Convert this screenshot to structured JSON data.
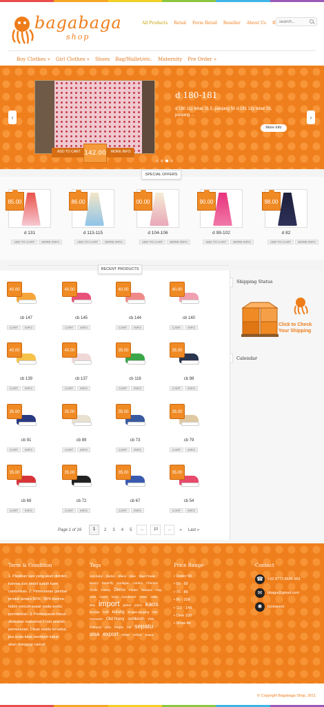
{
  "colors": {
    "brand": "#ef7f1d",
    "stripe": [
      "#e84c4c",
      "#f5a623",
      "#f2d024",
      "#8cc63f",
      "#3cb4e5",
      "#9b59b6"
    ]
  },
  "logo": {
    "word": "bagabaga",
    "sub": "shop"
  },
  "topnav": [
    {
      "label": "All Products",
      "active": true
    },
    {
      "label": "Retail"
    },
    {
      "label": "Form Retail"
    },
    {
      "label": "Reseller"
    },
    {
      "label": "About Us"
    },
    {
      "label": "Blog"
    }
  ],
  "search": {
    "placeholder": "search..."
  },
  "catnav": [
    "Boy Clothes »",
    "Girl Clothes »",
    "Shoes",
    "Bag/Wallet/etc.",
    "Maternity",
    "Pre Order »"
  ],
  "slider": {
    "title": "d 180-181",
    "desc": "d 180 11y lebar 31,5, panjang 50 d 181 13y lebar 33, panjang ...",
    "price": "142.00",
    "add_label": "ADD TO CART",
    "info_label": "MORE INFO",
    "more_label": "More Info",
    "prev": "‹",
    "next": "›"
  },
  "special": {
    "label": "SPECIAL OFFERS",
    "items": [
      {
        "name": "d 131",
        "price": "85.00"
      },
      {
        "name": "d 113-115",
        "price": "86.00"
      },
      {
        "name": "d 104-106",
        "price": "00.00"
      },
      {
        "name": "d 99-102",
        "price": "90.00"
      },
      {
        "name": "d 82",
        "price": "98.00"
      }
    ],
    "add": "ADD TO CART",
    "info": "MORE INFO"
  },
  "recent": {
    "label": "RECENT PRODUCTS",
    "cart": "CART",
    "info": "INFO",
    "items": [
      {
        "name": "cb 147",
        "price": "40.00"
      },
      {
        "name": "cb 145",
        "price": "40.00"
      },
      {
        "name": "cb 144",
        "price": "40.00"
      },
      {
        "name": "cb 140",
        "price": "40.00"
      },
      {
        "name": "cb 139",
        "price": "40.00"
      },
      {
        "name": "cb 137",
        "price": "40.00"
      },
      {
        "name": "cb 116",
        "price": "35.00"
      },
      {
        "name": "cb 98",
        "price": "35.00"
      },
      {
        "name": "cb 91",
        "price": "35.00"
      },
      {
        "name": "cb 89",
        "price": "35.00"
      },
      {
        "name": "cb 73",
        "price": "35.00"
      },
      {
        "name": "cb 79",
        "price": "35.00"
      },
      {
        "name": "cb 69",
        "price": "35.00"
      },
      {
        "name": "cb 72",
        "price": "35.00"
      },
      {
        "name": "cb 67",
        "price": "35.00"
      },
      {
        "name": "cb 54",
        "price": "35.00"
      }
    ]
  },
  "pagination": {
    "info": "Page 1 of 16",
    "pages": [
      "1",
      "2",
      "3",
      "4",
      "5",
      "...",
      "10",
      "...",
      "»",
      "Last »"
    ]
  },
  "sidebar": {
    "shipping": "Shipping Status",
    "ship_cta": "Click to Check Your Shipping",
    "calendar": "Calendar"
  },
  "footer": {
    "terms_title": "Term & Condition",
    "terms": "1. Pastikan size yang akan diorder, karena size detail sudah kami cantumkan. 2. Pemesanan gambar produk antara 80% - 95% karena faktor pencahayaan pada waktu pemotretan. 3. Pembayaran harus dilakukan maksimal 2 hari setelah pemesanan. Diluar waktu tersebut, jika anda tidak memberi kabar akan dianggap cancel.",
    "tags_title": "Tags",
    "tags": [
      "Anti baby",
      "Barbie",
      "Blank",
      "Blue",
      "Blue Flower",
      "Bunny",
      "Butterfly",
      "Cardigan",
      "Carters",
      "Cherries",
      "Circle",
      "Disney",
      "Dress",
      "Faded",
      "Glasses",
      "Gap",
      "Girls",
      "Green",
      "Grey",
      "Gymboree",
      "Heart",
      "Hello kitty",
      "import",
      "jacket",
      "jeans",
      "kaos",
      "kemeja",
      "kuffi",
      "kutung",
      "lengan panjang",
      "Mix",
      "momcare",
      "Old Navy",
      "oshkosh",
      "Pink",
      "Polkadot",
      "polo",
      "Purple",
      "rok",
      "sepatu",
      "sisa",
      "export",
      "White",
      "Yellow",
      "Zaara"
    ],
    "price_title": "Price Range",
    "prices": [
      "Under 50",
      "50 - 69",
      "70 - 89",
      "90 - 109",
      "110 - 149",
      "Over 150",
      "Show All"
    ],
    "contact_title": "Contact",
    "phone": "+62 8773 8686 963",
    "email": "bbaga@gmail.com",
    "bbm": "byrequest"
  },
  "copyright": "© Copyright Bagabaga Shop, 2011"
}
